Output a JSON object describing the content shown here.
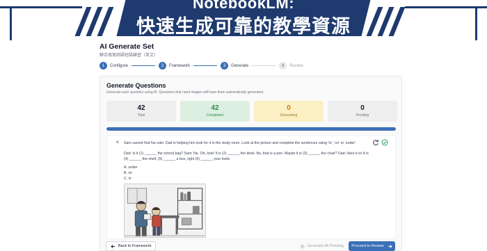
{
  "banner": {
    "top_text": "NotebookLM:",
    "main_text": "快速生成可靠的教學資源"
  },
  "header": {
    "title": "AI Generate Set",
    "subtitle": "聯合填寫詞語短語練習（英文）"
  },
  "steps": [
    {
      "num": "1",
      "label": "Configure",
      "state": "done"
    },
    {
      "num": "2",
      "label": "Framework",
      "state": "done"
    },
    {
      "num": "3",
      "label": "Generate",
      "state": "active"
    },
    {
      "num": "4",
      "label": "Review",
      "state": "inactive"
    }
  ],
  "card": {
    "title": "Generate Questions",
    "subtitle": "Generate each question using AI. Questions that need images will have them automatically generated."
  },
  "stats": {
    "total": {
      "value": "42",
      "label": "Total"
    },
    "completed": {
      "value": "42",
      "label": "Completed"
    },
    "generating": {
      "value": "0",
      "label": "Generating"
    },
    "pending": {
      "value": "0",
      "label": "Pending"
    }
  },
  "progress": {
    "fraction": 1.0
  },
  "question": {
    "number": "4.",
    "prompt": "Sam cannot find his ruler. Dad is helping him look for it in the study room. Look at the picture and complete the sentences using 'in', 'on' or 'under'.",
    "body_line1": "Dad: Is it (1) ______ the school bag? Sam: No. Oh, look! It is (2) ______ the desk. No, that is a pen. Maybe it is (3) ______ the chair? Dad: Here it is! It is",
    "body_line2": "(4) ______ the shelf, (5) ______ a box, right (6) ______ your book.",
    "options": [
      "A.  under",
      "B.  on",
      "C.  in"
    ]
  },
  "footer": {
    "back_label": "Back to Framework",
    "generate_all_label": "Generate All Pending",
    "proceed_label": "Proceed to Review"
  },
  "colors": {
    "brand": "#1e3a6e",
    "accent": "#3b6fb6",
    "completed": "#2f8a4a",
    "generating": "#d97706"
  },
  "icons": [
    "regenerate-icon",
    "check-circle-icon",
    "arrow-left-icon",
    "sparkle-icon",
    "arrow-right-icon"
  ]
}
